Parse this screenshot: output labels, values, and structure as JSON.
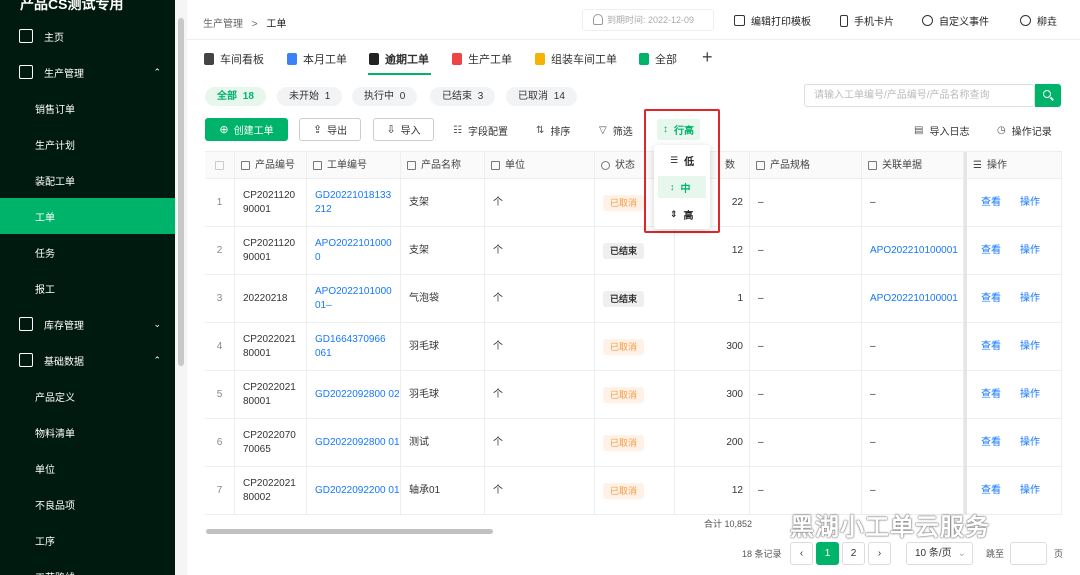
{
  "app": {
    "title": "产品CS测试专用"
  },
  "sidebar": {
    "items": [
      {
        "label": "主页",
        "icon": "home-icon"
      },
      {
        "label": "生产管理",
        "icon": "production-icon",
        "expanded": true
      },
      {
        "label": "销售订单"
      },
      {
        "label": "生产计划"
      },
      {
        "label": "装配工单"
      },
      {
        "label": "工单",
        "active": true
      },
      {
        "label": "任务"
      },
      {
        "label": "报工"
      },
      {
        "label": "库存管理",
        "icon": "inventory-icon"
      },
      {
        "label": "基础数据",
        "icon": "database-icon",
        "expanded": true
      },
      {
        "label": "产品定义"
      },
      {
        "label": "物料清单"
      },
      {
        "label": "单位"
      },
      {
        "label": "不良品项"
      },
      {
        "label": "工序"
      },
      {
        "label": "工艺路线"
      }
    ]
  },
  "header": {
    "breadcrumb_parent": "生产管理",
    "breadcrumb_sep": ">",
    "breadcrumb_current": "工单",
    "expire": "到期时间: 2022-12-09",
    "actions": [
      "编辑打印模板",
      "手机卡片",
      "自定义事件"
    ],
    "user": "柳垚"
  },
  "tabs": [
    "车间看板",
    "本月工单",
    "逾期工单",
    "生产工单",
    "组装车间工单",
    "全部"
  ],
  "filters": [
    {
      "label": "全部",
      "count": "18",
      "active": true
    },
    {
      "label": "未开始",
      "count": "1"
    },
    {
      "label": "执行中",
      "count": "0"
    },
    {
      "label": "已结束",
      "count": "3"
    },
    {
      "label": "已取消",
      "count": "14"
    }
  ],
  "search": {
    "placeholder": "请输入工单编号/产品编号/产品名称查询"
  },
  "toolbar": {
    "create": "创建工单",
    "export": "导出",
    "import": "导入",
    "field_config": "字段配置",
    "sort": "排序",
    "filter": "筛选",
    "row_height": "行高",
    "import_log": "导入日志",
    "op_log": "操作记录"
  },
  "row_height_menu": [
    "低",
    "中",
    "高"
  ],
  "table": {
    "columns": [
      "产品编号",
      "工单编号",
      "产品名称",
      "单位",
      "状态",
      "数",
      "产品规格",
      "关联单据",
      "操作"
    ],
    "rows": [
      {
        "idx": "1",
        "product_no": "CP2021120 90001",
        "order_no": "GD20221018133 212",
        "name": "支架",
        "unit": "个",
        "status": "已取消",
        "qty": "22",
        "spec": "–",
        "related": "–"
      },
      {
        "idx": "2",
        "product_no": "CP2021120 90001",
        "order_no": "APO2022101000 0",
        "name": "支架",
        "unit": "个",
        "status": "已结束",
        "qty": "12",
        "spec": "–",
        "related": "APO202210100001"
      },
      {
        "idx": "3",
        "product_no": "20220218",
        "order_no": "APO2022101000 01–",
        "name": "气泡袋",
        "unit": "个",
        "status": "已结束",
        "qty": "1",
        "spec": "–",
        "related": "APO202210100001"
      },
      {
        "idx": "4",
        "product_no": "CP2022021 80001",
        "order_no": "GD1664370966 061",
        "name": "羽毛球",
        "unit": "个",
        "status": "已取消",
        "qty": "300",
        "spec": "–",
        "related": "–"
      },
      {
        "idx": "5",
        "product_no": "CP2022021 80001",
        "order_no": "GD2022092800 02",
        "name": "羽毛球",
        "unit": "个",
        "status": "已取消",
        "qty": "300",
        "spec": "–",
        "related": "–"
      },
      {
        "idx": "6",
        "product_no": "CP2022070 70065",
        "order_no": "GD2022092800 01",
        "name": "测试",
        "unit": "个",
        "status": "已取消",
        "qty": "200",
        "spec": "–",
        "related": "–"
      },
      {
        "idx": "7",
        "product_no": "CP2022021 80002",
        "order_no": "GD2022092200 01",
        "name": "轴承01",
        "unit": "个",
        "status": "已取消",
        "qty": "12",
        "spec": "–",
        "related": "–"
      }
    ],
    "op_view": "查看",
    "op_action": "操作",
    "total": "合计 10,852"
  },
  "pagination": {
    "records": "18 条记录",
    "pages": [
      "1",
      "2"
    ],
    "page_size": "10 条/页",
    "goto": "跳至",
    "page_unit": "页"
  },
  "watermark": "黑湖小工单云服务",
  "colors": {
    "brand": "#00b36b",
    "sidebar": "#001a10",
    "link": "#1677ff",
    "highlight": "#e0262b"
  }
}
